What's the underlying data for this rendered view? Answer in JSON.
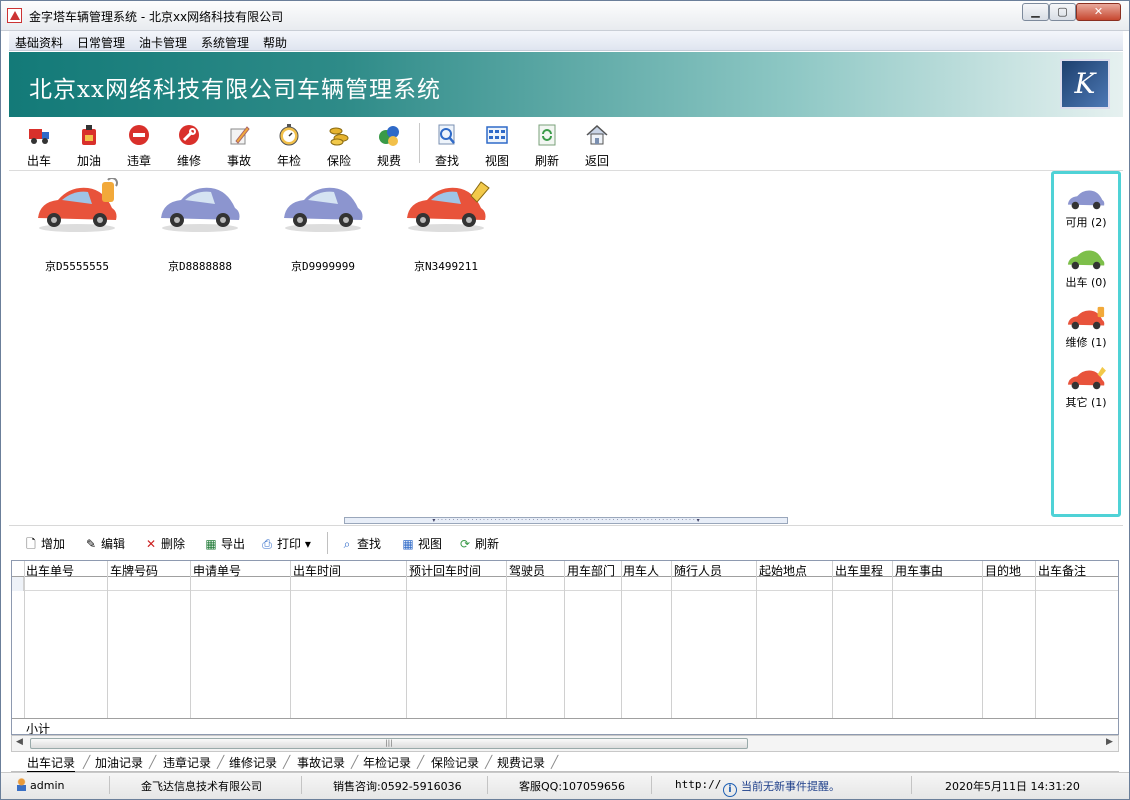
{
  "window": {
    "title": "金字塔车辆管理系统 - 北京xx网络科技有限公司",
    "controls": {
      "minimize": "▁",
      "maximize": "▢",
      "close": "✕"
    }
  },
  "menu": [
    "基础资料",
    "日常管理",
    "油卡管理",
    "系统管理",
    "帮助"
  ],
  "banner": {
    "title": "北京xx网络科技有限公司车辆管理系统"
  },
  "toolbar": [
    {
      "label": "出车",
      "icon": "truck-icon"
    },
    {
      "label": "加油",
      "icon": "fuel-can-icon"
    },
    {
      "label": "违章",
      "icon": "no-entry-icon"
    },
    {
      "label": "维修",
      "icon": "wrench-icon"
    },
    {
      "label": "事故",
      "icon": "pencil-icon"
    },
    {
      "label": "年检",
      "icon": "stopwatch-icon"
    },
    {
      "label": "保险",
      "icon": "coins-icon"
    },
    {
      "label": "规费",
      "icon": "money-bag-icon"
    },
    {
      "label": "查找",
      "icon": "magnifier-icon"
    },
    {
      "label": "视图",
      "icon": "grid-view-icon"
    },
    {
      "label": "刷新",
      "icon": "refresh-icon"
    },
    {
      "label": "返回",
      "icon": "home-icon"
    }
  ],
  "cars": [
    {
      "plate": "京D5555555",
      "status": "维修",
      "color": "#e8533b",
      "badge": "wrench"
    },
    {
      "plate": "京D8888888",
      "status": "可用",
      "color": "#8c95cf",
      "badge": ""
    },
    {
      "plate": "京D9999999",
      "status": "可用",
      "color": "#8c95cf",
      "badge": ""
    },
    {
      "plate": "京N3499211",
      "status": "其它",
      "color": "#e8533b",
      "badge": "tag"
    }
  ],
  "status_panel": [
    {
      "label": "可用 (2)",
      "color": "#8c95cf"
    },
    {
      "label": "出车 (0)",
      "color": "#7dbf4a"
    },
    {
      "label": "维修 (1)",
      "color": "#e8533b"
    },
    {
      "label": "其它 (1)",
      "color": "#e8533b"
    }
  ],
  "lower_toolbar": {
    "add": "增加",
    "edit": "编辑",
    "delete": "删除",
    "export": "导出",
    "print": "打印",
    "print_arrow": "▾",
    "find": "查找",
    "view": "视图",
    "refresh": "刷新"
  },
  "grid": {
    "columns": [
      "出车单号",
      "车牌号码",
      "申请单号",
      "出车时间",
      "预计回车时间",
      "驾驶员",
      "用车部门",
      "用车人",
      "随行人员",
      "起始地点",
      "出车里程",
      "用车事由",
      "目的地",
      "出车备注"
    ],
    "footer": "小计",
    "scroll_grip": "|||",
    "scroll_left": "◀",
    "scroll_right": "▶"
  },
  "tabs": [
    "出车记录",
    "加油记录",
    "违章记录",
    "维修记录",
    "事故记录",
    "年检记录",
    "保险记录",
    "规费记录"
  ],
  "statusbar": {
    "user": "admin",
    "company": "金飞达信息技术有限公司",
    "sales": "销售咨询:0592-5916036",
    "support": "客服QQ:107059656",
    "url": "http://",
    "notice": "当前无新事件提醒。",
    "datetime": "2020年5月11日  14:31:20"
  }
}
